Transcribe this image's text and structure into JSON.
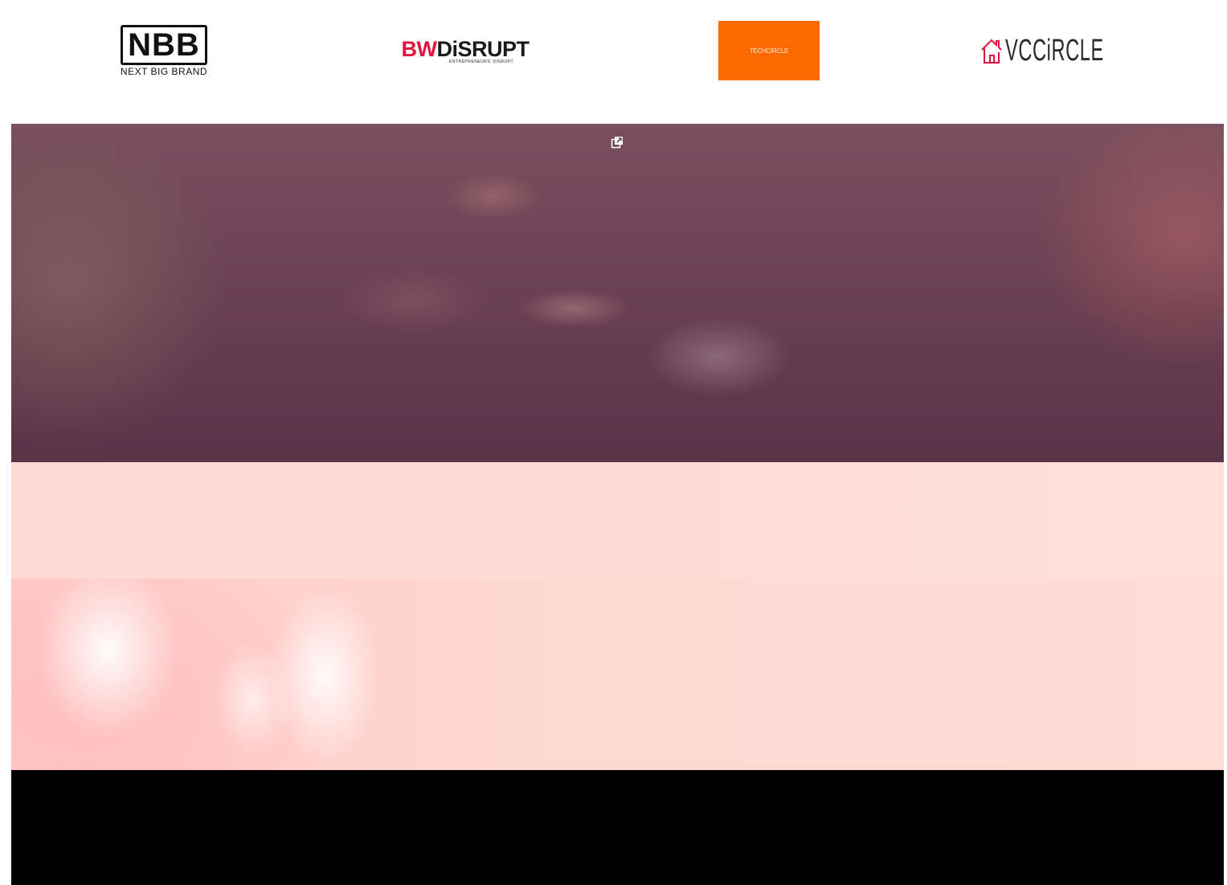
{
  "partners": {
    "nbb": {
      "mark": "NBB",
      "tagline": "NEXT BIG BRAND"
    },
    "bw_disrupt": {
      "prefix": "BW",
      "name": "DiSRUPT",
      "tagline": "ENTREPRENEURS' DISRUPT"
    },
    "techcircle": {
      "name": "TECHCIRCLE",
      "bg_color": "#ff6a00"
    },
    "vccircle": {
      "name": "VCCiRCLE"
    }
  },
  "video": {
    "popout_icon": "external-popout-icon"
  }
}
